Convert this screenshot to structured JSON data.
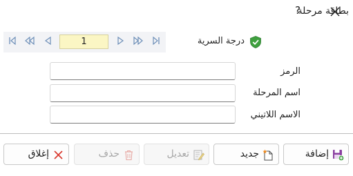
{
  "window": {
    "title": "بطاقة مرحلة",
    "help_label": "?"
  },
  "navigator": {
    "current_page": "1"
  },
  "security": {
    "label": "درجة السرية"
  },
  "fields": [
    {
      "label": "الرمز",
      "value": ""
    },
    {
      "label": "اسم المرحلة",
      "value": ""
    },
    {
      "label": "الاسم اللاتيني",
      "value": ""
    }
  ],
  "buttons": {
    "add": "إضافة",
    "new": "جديد",
    "edit": "تعديل",
    "delete": "حذف",
    "close": "إغلاق"
  },
  "colors": {
    "page_box": "#fbf6c4",
    "nav_arrows": "#6d8fb8",
    "shield": "#3fa03f",
    "close_icon": "#d9362c",
    "add_icon": "#8a3fa0"
  }
}
